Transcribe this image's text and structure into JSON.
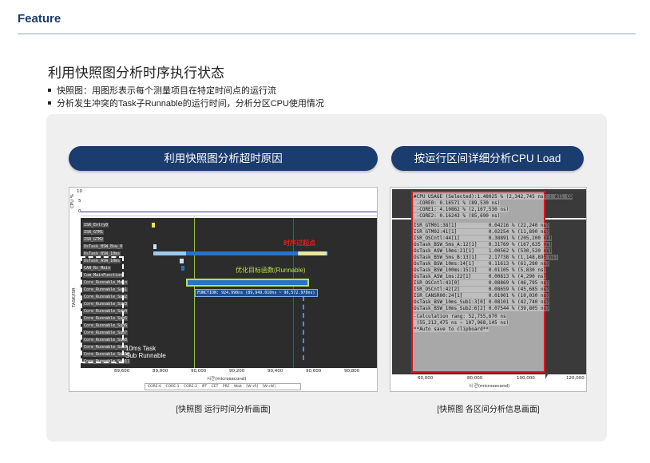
{
  "header": {
    "title": "Feature"
  },
  "main": {
    "title": "利用快照图分析时序执行状态",
    "bullets": [
      "快照图：用图形表示每个测量项目在特定时间点的运行流",
      "分析发生冲突的Task子Runnable的运行时间，分析分区CPU使用情况"
    ]
  },
  "left_card": {
    "button_label": "利用快照图分析超时原因",
    "caption": "[快照图 运行时间分析画面]",
    "screenshot": {
      "y_label_top": "CPU %",
      "y_ticks": [
        "10",
        "5",
        "0"
      ],
      "y_label_tasks": "TASK/ISR",
      "rows": [
        "ISR_Entry0",
        "ISR_GTM1",
        "ISR_GTM2",
        "OsTask_BSW_Bsw_0",
        "OsTask_BSW_10ms",
        "OsTask_ASW_10ms",
        "CAN_Rx_Main",
        "Com_MainFunction",
        "Core_Runnable_Main",
        "Core_Runnable_Sub1",
        "Core_Runnable_Sub2",
        "Core_Runnable_Sub3",
        "Core_Runnable_Sub4",
        "Core_Runnable_Sub5",
        "Core_Runnable_Sub6",
        "Core_Runnable_Sub7",
        "Core_Runnable_Sub8",
        "Core_Runnable_Sub9",
        "Core_Runnable_Sub10",
        "Core_Runnable_Sub11"
      ],
      "annot_timing": "时序过起点",
      "annot_runnable": "优化目标函数(Runnable)",
      "function_box": "FUNCTION: 924.990ns (89,949.010ns ~ 90,572.970ns)",
      "annot_task_line1": "10ms Task",
      "annot_task_line2": "Sub Runnable",
      "x_ticks": [
        "89,600",
        "89,800",
        "90,000",
        "90,200",
        "90,400",
        "90,600",
        "90,800"
      ],
      "x_label": "시간(microsecond)",
      "legend": [
        "CORE:0",
        "CORE:1",
        "CORE:2",
        "IPT",
        "CET",
        "PRE",
        "Wait",
        "[W→R]",
        "[W→W]"
      ]
    }
  },
  "right_card": {
    "button_label": "按运行区间详细分析CPU Load",
    "caption": "[快照图 各区间分析信息画面]",
    "screenshot": {
      "lines": [
        "#CPU USAGE (Selected):1.48025 % (2,342,745 ns) : All CO",
        " -CORE0: 0.16571 % (89,530 ns)",
        " -CORE1: 4.10862 % (2,167,530 ns)",
        " -CORE2: 0.16243 % (85,690 ns)",
        "",
        "ISR_GTM01:38[1]           0.04216 % (22,240 ns)",
        "ISR_GTM02:41[1]           0.02254 % (11,890 ns)",
        "ISR_OSCntl:44[1]          0.38891 % (205,200 ns)",
        "OsTask_BSW_5ms_A:12[1]    0.31769 % (167,635 ns)",
        "OsTask_ASW_10ms:21[1]     1.00562 % (530,520 ns)",
        "OsTask_BSW_5ms_B:13[1]    2.17738 % (1,148,895 ns)",
        "OsTask_BSW_10ms:14[1]     0.11613 % (61,280 ns)",
        "OsTask_BSW_100ms:15[1]    0.01105 % (5,830 ns)",
        "OsTask_ASW_1ms:22[1]      0.00813 % (4,290 ns)",
        "ISR_OSCntl:43[0]          0.08869 % (46,795 ns)",
        "ISR_OSCntl:42[2]          0.08659 % (45,685 ns)",
        "ISR_CANSR00:24[1]         0.01901 % (10,030 ns)",
        "OsTask_BSW_10ms_Sub1:3[0] 0.08101 % (42,740 ns)",
        "OsTask_BSW_10ms_Sub2:6[2] 0.07544 % (39,805 ns)",
        "",
        "-Calculation rang: 52,755,670 ns",
        " (55,212,475 ns ~ 107,968,145 ns)",
        "**Auto save to clipboard**"
      ],
      "x_ticks": [
        "60,000",
        "80,000",
        "100,000",
        "120,000"
      ],
      "x_label": "시 간(microsecond)"
    }
  }
}
